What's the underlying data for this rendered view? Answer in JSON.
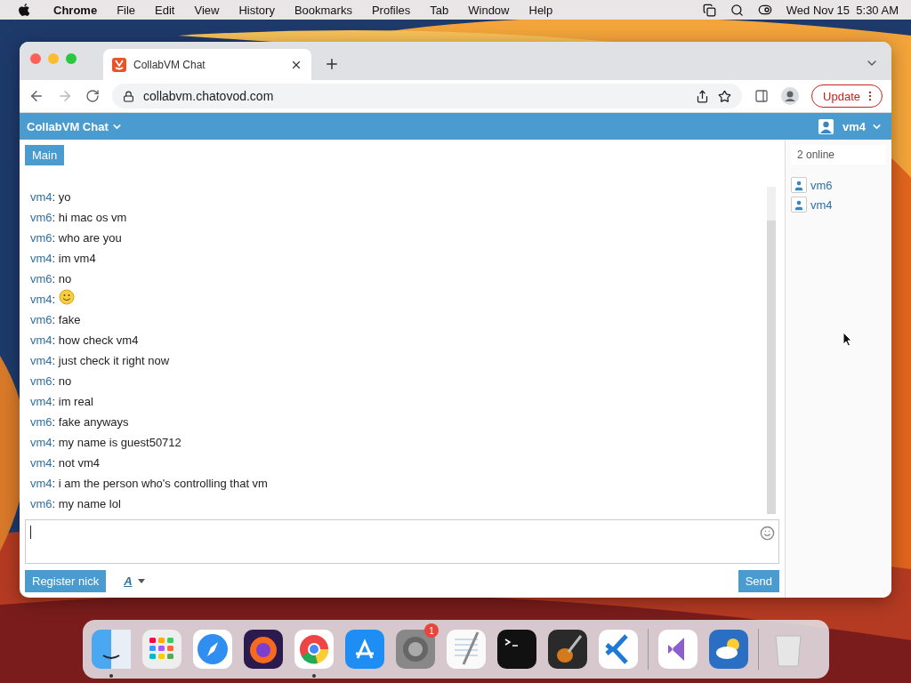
{
  "menu_bar": {
    "app": "Chrome",
    "items": [
      "File",
      "Edit",
      "View",
      "History",
      "Bookmarks",
      "Profiles",
      "Tab",
      "Window",
      "Help"
    ],
    "clock": "Wed Nov 15  5:30 AM"
  },
  "browser": {
    "tab": {
      "title": "CollabVM Chat",
      "selected": true
    },
    "url": "collabvm.chatovod.com",
    "update_button": "Update"
  },
  "app_bar": {
    "title": "CollabVM Chat",
    "user": "vm4"
  },
  "rooms": [
    {
      "label": "Main",
      "selected": true
    }
  ],
  "messages": [
    {
      "user": "vm4",
      "kind": "text",
      "text": ": yo"
    },
    {
      "user": "vm6",
      "kind": "text",
      "text": ": hi mac os vm"
    },
    {
      "user": "vm6",
      "kind": "text",
      "text": ": who are you"
    },
    {
      "user": "vm4",
      "kind": "text",
      "text": ": im vm4"
    },
    {
      "user": "vm6",
      "kind": "text",
      "text": ": no"
    },
    {
      "user": "vm4",
      "kind": "emoji",
      "text": ":"
    },
    {
      "user": "vm6",
      "kind": "text",
      "text": ": fake"
    },
    {
      "user": "vm4",
      "kind": "text",
      "text": ": how check vm4"
    },
    {
      "user": "vm4",
      "kind": "text",
      "text": ": just check it right now"
    },
    {
      "user": "vm6",
      "kind": "text",
      "text": ": no"
    },
    {
      "user": "vm4",
      "kind": "text",
      "text": ": im real"
    },
    {
      "user": "vm6",
      "kind": "text",
      "text": ": fake anyways"
    },
    {
      "user": "vm4",
      "kind": "text",
      "text": ": my name is guest50712"
    },
    {
      "user": "vm4",
      "kind": "text",
      "text": ": not vm4"
    },
    {
      "user": "vm4",
      "kind": "text",
      "text": ": i am the person who's controlling that vm"
    },
    {
      "user": "vm6",
      "kind": "text",
      "text": ": my name lol"
    }
  ],
  "online": {
    "count": "2 online",
    "users": [
      "vm6",
      "vm4"
    ]
  },
  "composer": {
    "register_button": "Register nick",
    "format_label": "A",
    "send_button": "Send"
  },
  "dock": [
    {
      "running": true
    },
    {
      "running": false
    },
    {
      "running": false
    },
    {
      "running": false
    },
    {
      "running": true
    },
    {
      "running": false
    },
    {
      "running": false,
      "badge": "1"
    },
    {
      "running": false
    },
    {
      "running": false
    },
    {
      "running": false
    },
    {
      "running": false
    },
    {
      "running": false
    },
    {
      "running": false
    },
    {
      "running": false
    }
  ]
}
